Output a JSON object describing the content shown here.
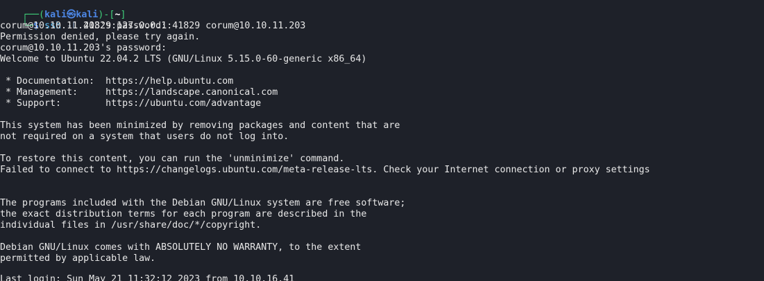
{
  "prompt": {
    "box_top_left": "┌──(",
    "user": "kali",
    "at_symbol": "㉿",
    "host": "kali",
    "bracket_mid": ")-[",
    "cwd": "~",
    "bracket_end": "]",
    "box_bottom_left": "└─",
    "dollar": "$"
  },
  "command": {
    "program": "ssh",
    "flag": "-L",
    "forward_spec": "41829:127.0.0.1:41829",
    "target": "corum@10.10.11.203"
  },
  "output_lines": [
    "corum@10.10.11.203's password:",
    "Permission denied, please try again.",
    "corum@10.10.11.203's password:",
    "Welcome to Ubuntu 22.04.2 LTS (GNU/Linux 5.15.0-60-generic x86_64)",
    "",
    " * Documentation:  https://help.ubuntu.com",
    " * Management:     https://landscape.canonical.com",
    " * Support:        https://ubuntu.com/advantage",
    "",
    "This system has been minimized by removing packages and content that are",
    "not required on a system that users do not log into.",
    "",
    "To restore this content, you can run the 'unminimize' command.",
    "Failed to connect to https://changelogs.ubuntu.com/meta-release-lts. Check your Internet connection or proxy settings",
    "",
    "",
    "The programs included with the Debian GNU/Linux system are free software;",
    "the exact distribution terms for each program are described in the",
    "individual files in /usr/share/doc/*/copyright.",
    "",
    "Debian GNU/Linux comes with ABSOLUTELY NO WARRANTY, to the extent",
    "permitted by applicable law.",
    "",
    "Last login: Sun May 21 11:32:12 2023 from 10.10.16.41"
  ]
}
